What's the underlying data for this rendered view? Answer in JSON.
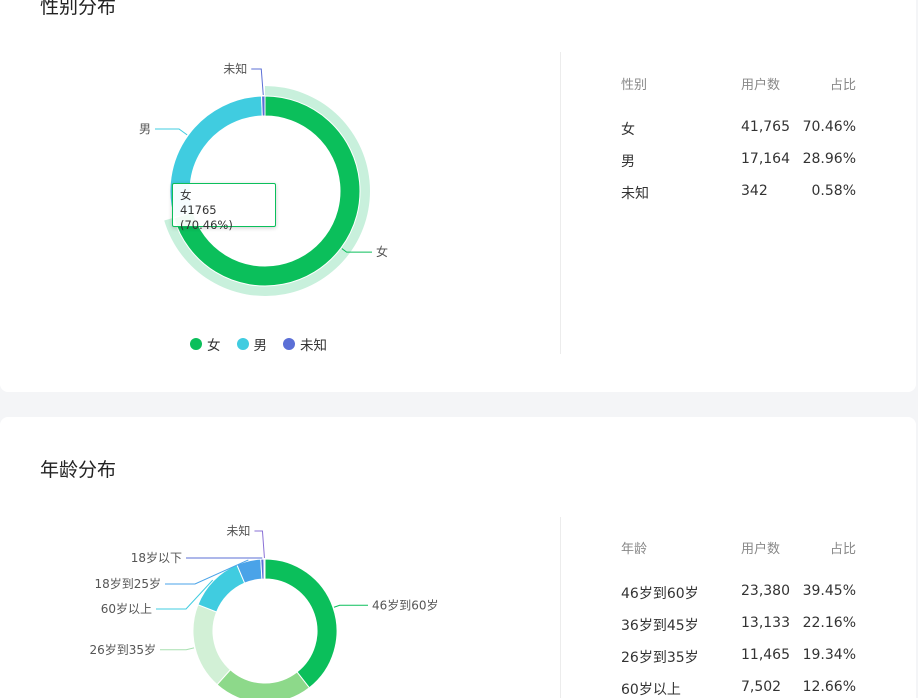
{
  "gender": {
    "title": "性别分布",
    "table": {
      "headers": [
        "性别",
        "用户数",
        "占比"
      ],
      "rows": [
        [
          "女",
          "41,765",
          "70.46%"
        ],
        [
          "男",
          "17,164",
          "28.96%"
        ],
        [
          "未知",
          "342",
          "0.58%"
        ]
      ]
    },
    "tooltip": {
      "name": "女",
      "value": "41765 (70.46%)"
    },
    "legend": [
      "女",
      "男",
      "未知"
    ],
    "chart_data": {
      "type": "pie",
      "categories": [
        "女",
        "男",
        "未知"
      ],
      "values": [
        41765,
        17164,
        342
      ],
      "colors": [
        "#0bbf5b",
        "#40cce0",
        "#5b6fd6"
      ],
      "highlight_color": "#c8f0dc"
    }
  },
  "age": {
    "title": "年龄分布",
    "table": {
      "headers": [
        "年龄",
        "用户数",
        "占比"
      ],
      "rows": [
        [
          "46岁到60岁",
          "23,380",
          "39.45%"
        ],
        [
          "36岁到45岁",
          "13,133",
          "22.16%"
        ],
        [
          "26岁到35岁",
          "11,465",
          "19.34%"
        ],
        [
          "60岁以上",
          "7,502",
          "12.66%"
        ]
      ]
    },
    "chart_data": {
      "type": "pie",
      "categories": [
        "46岁到60岁",
        "36岁到45岁",
        "26岁到35岁",
        "60岁以上",
        "18岁到25岁",
        "18岁以下",
        "未知"
      ],
      "values": [
        39.45,
        22.16,
        19.34,
        12.66,
        5.45,
        0.7,
        0.24
      ],
      "colors": [
        "#0bbf5b",
        "#8dd98a",
        "#d2f0d6",
        "#40cce0",
        "#4aa3e8",
        "#5b6fd6",
        "#8a70d6"
      ],
      "labels_shown": [
        "46岁到60岁",
        "26岁到35岁",
        "60岁以上",
        "18岁到25岁",
        "18岁以下",
        "未知"
      ]
    }
  }
}
